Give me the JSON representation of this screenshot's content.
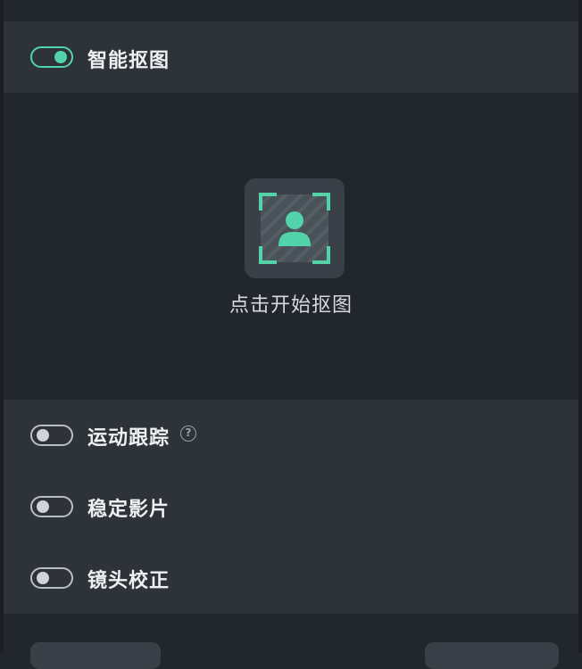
{
  "smart_matting": {
    "label": "智能抠图",
    "enabled": true
  },
  "preview": {
    "button_icon": "person-matting-icon",
    "caption": "点击开始抠图"
  },
  "options": [
    {
      "label": "运动跟踪",
      "enabled": false,
      "help_icon": "question-circle-icon"
    },
    {
      "label": "稳定影片",
      "enabled": false
    },
    {
      "label": "镜头校正",
      "enabled": false
    }
  ],
  "help": {
    "glyph": "?"
  },
  "colors": {
    "accent": "#52d3aa",
    "panel": "#2d3339",
    "background": "#22272e"
  }
}
